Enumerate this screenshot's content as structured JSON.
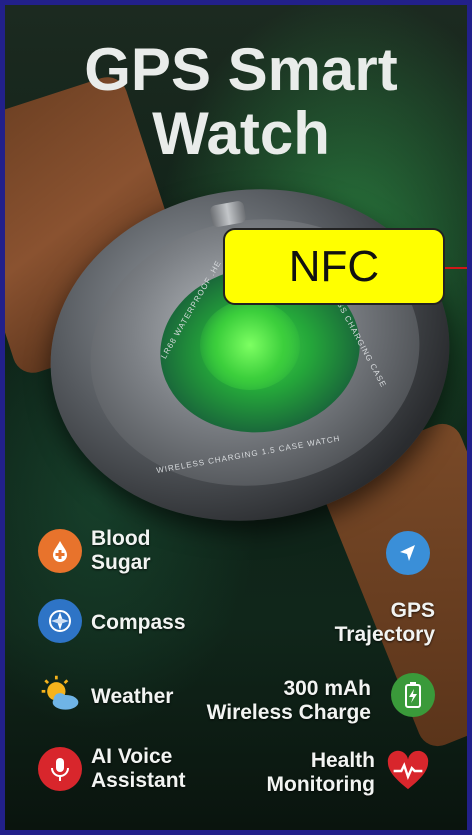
{
  "title_line1": "GPS Smart",
  "title_line2": "Watch",
  "callout": "NFC",
  "engraving": {
    "left_arc": "LR68 WATERPROOF .HE",
    "right_arc": "LESS CHARGING CASE",
    "bottom_arc": "WIRELESS CHARGING 1.5 CASE WATCH"
  },
  "features_left": [
    {
      "icon": "blood-drop-icon",
      "color": "#e8732c",
      "line1": "Blood",
      "line2": "Sugar"
    },
    {
      "icon": "compass-icon",
      "color": "#2e74c6",
      "line1": "Compass",
      "line2": ""
    },
    {
      "icon": "sun-cloud-icon",
      "color": "#f2b21a",
      "line1": "Weather",
      "line2": ""
    },
    {
      "icon": "microphone-icon",
      "color": "#d8262c",
      "line1": "AI Voice",
      "line2": "Assistant"
    }
  ],
  "features_right": [
    {
      "icon": "navigation-icon",
      "color": "#3a8fd8",
      "line1": "GPS",
      "line2": "Trajectory"
    },
    {
      "icon": "battery-charge-icon",
      "color": "#3a9a3a",
      "line1": "300 mAh",
      "line2": "Wireless Charge"
    },
    {
      "icon": "heart-rate-icon",
      "color": "#d8262c",
      "line1": "Health",
      "line2": "Monitoring"
    }
  ],
  "colors": {
    "frame": "#22208a",
    "callout_bg": "#ffff00",
    "callout_line": "#d01818",
    "title_text": "#e9ecea"
  }
}
